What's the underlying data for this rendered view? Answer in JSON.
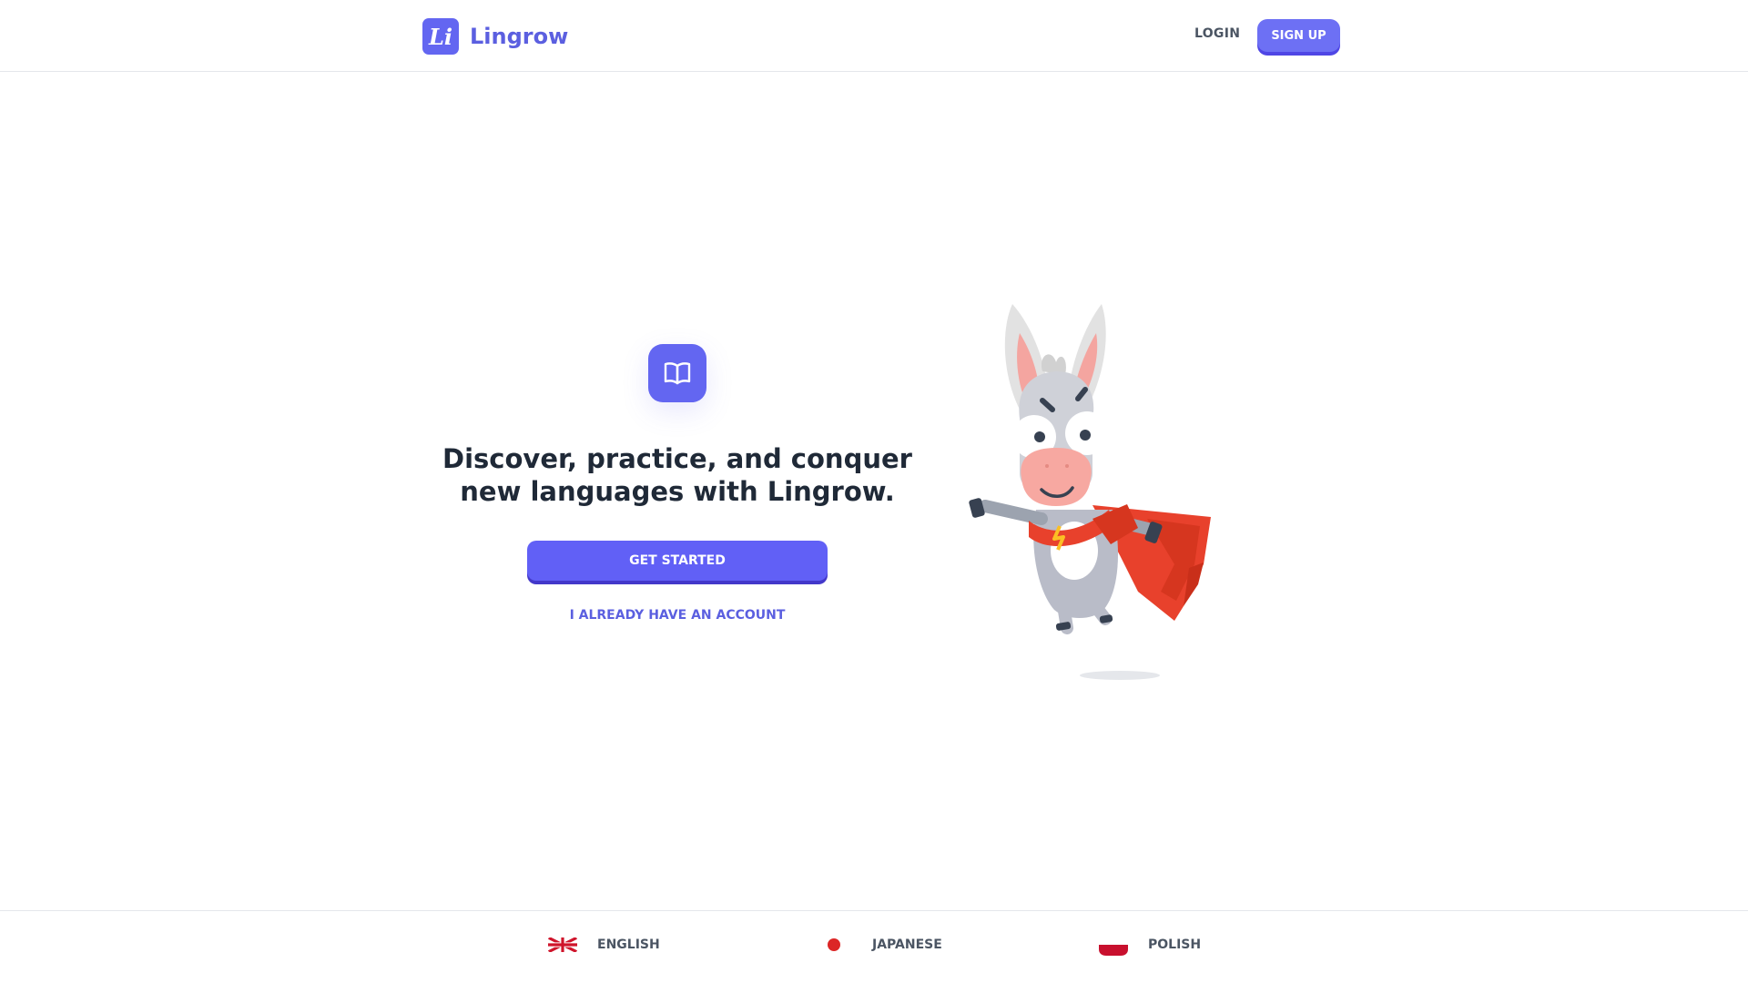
{
  "brand": {
    "logo_text": "Li",
    "name": "Lingrow"
  },
  "header": {
    "login_label": "LOGIN",
    "signup_label": "SIGN UP"
  },
  "hero": {
    "headline": "Discover, practice, and conquer new languages with Lingrow.",
    "primary_cta": "GET STARTED",
    "secondary_cta": "I ALREADY HAVE AN ACCOUNT",
    "icon": "book-open-icon"
  },
  "mascot": {
    "icon": "donkey-superhero-icon"
  },
  "footer": {
    "languages": [
      {
        "label": "ENGLISH",
        "icon": "flag-uk-icon"
      },
      {
        "label": "JAPANESE",
        "icon": "flag-japan-icon"
      },
      {
        "label": "POLISH",
        "icon": "flag-poland-icon"
      }
    ]
  },
  "colors": {
    "brand": "#6366f1",
    "text_dark": "#1f2937",
    "text_muted": "#4b5563",
    "cape_red": "#e8412c"
  }
}
